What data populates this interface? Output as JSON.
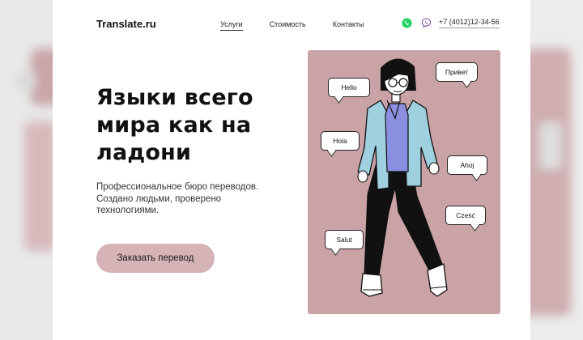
{
  "header": {
    "logo": "Translate.ru",
    "nav": [
      {
        "label": "Услуги",
        "active": true
      },
      {
        "label": "Стоимость",
        "active": false
      },
      {
        "label": "Контакты",
        "active": false
      }
    ],
    "phone": "+7 (4012)12-34-56",
    "icons": [
      "whatsapp-icon",
      "viber-icon"
    ]
  },
  "hero": {
    "headline_lines": [
      "Языки всего",
      "мира как на",
      "ладони"
    ],
    "subtitle_lines": [
      "Профессиональное бюро переводов.",
      "Создано людьми, проверено",
      "технологиями."
    ],
    "cta_label": "Заказать перевод"
  },
  "illustration": {
    "bubbles": [
      "Hello",
      "Привет",
      "Hola",
      "Ahoj",
      "Cześć",
      "Salut"
    ]
  },
  "colors": {
    "accent": "#d6b3b6",
    "illustration_bg": "#caa3a6",
    "whatsapp": "#25d366",
    "viber": "#7f4da0",
    "shirt": "#9fd0e0",
    "tshirt": "#8b8fe0"
  }
}
